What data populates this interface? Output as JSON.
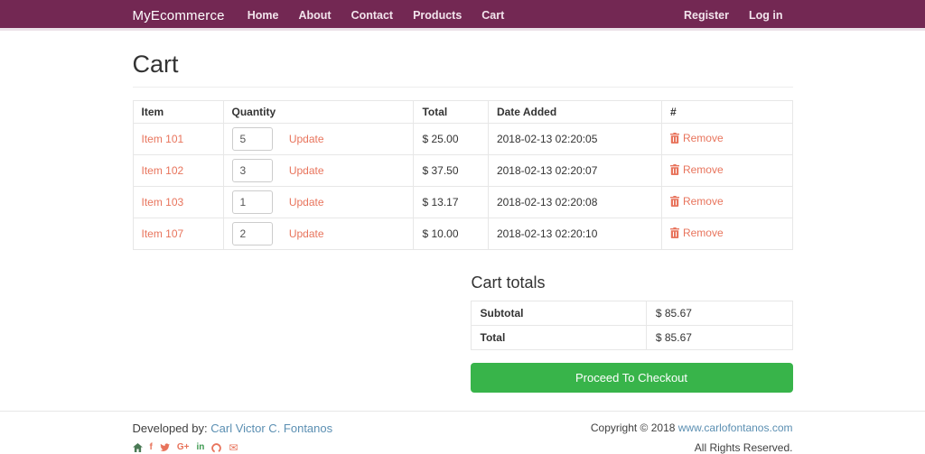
{
  "navbar": {
    "brand": "MyEcommerce",
    "items": [
      "Home",
      "About",
      "Contact",
      "Products",
      "Cart"
    ],
    "right_items": [
      "Register",
      "Log in"
    ]
  },
  "page": {
    "title": "Cart"
  },
  "cart_table": {
    "headers": [
      "Item",
      "Quantity",
      "Total",
      "Date Added",
      "#"
    ],
    "update_label": "Update",
    "remove_label": "Remove",
    "rows": [
      {
        "item": "Item 101",
        "quantity": "5",
        "total": "$ 25.00",
        "date_added": "2018-02-13 02:20:05"
      },
      {
        "item": "Item 102",
        "quantity": "3",
        "total": "$ 37.50",
        "date_added": "2018-02-13 02:20:07"
      },
      {
        "item": "Item 103",
        "quantity": "1",
        "total": "$ 13.17",
        "date_added": "2018-02-13 02:20:08"
      },
      {
        "item": "Item 107",
        "quantity": "2",
        "total": "$ 10.00",
        "date_added": "2018-02-13 02:20:10"
      }
    ]
  },
  "totals": {
    "title": "Cart totals",
    "rows": [
      {
        "label": "Subtotal",
        "value": "$ 85.67"
      },
      {
        "label": "Total",
        "value": "$ 85.67"
      }
    ],
    "checkout_label": "Proceed To Checkout"
  },
  "footer": {
    "developed_by": "Developed by:",
    "developer_link": "Carl Victor C. Fontanos",
    "copyright_prefix": "Copyright © 2018",
    "copyright_link": "www.carlofontanos.com",
    "rights": "All Rights Reserved.",
    "social": {
      "facebook_glyph": "f",
      "googleplus_glyph": "G+",
      "linkedin_glyph": "in",
      "email_glyph": "✉"
    }
  },
  "colors": {
    "navbar_bg": "#732853",
    "accent_orange": "#e8745c",
    "success_green": "#38b44a",
    "link_blue": "#5b8fb2"
  }
}
